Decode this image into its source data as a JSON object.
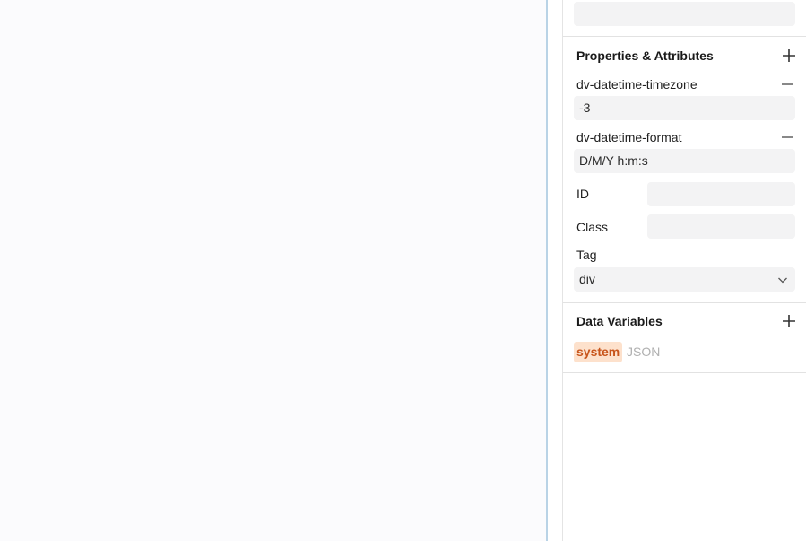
{
  "properties": {
    "title": "Properties & Attributes",
    "attributes": [
      {
        "name": "dv-datetime-timezone",
        "value": "-3"
      },
      {
        "name": "dv-datetime-format",
        "value": "D/M/Y h:m:s"
      }
    ],
    "id_label": "ID",
    "id_value": "",
    "class_label": "Class",
    "class_value": "",
    "tag_label": "Tag",
    "tag_value": "div"
  },
  "data_variables": {
    "title": "Data Variables",
    "items": [
      {
        "name": "system",
        "type": "JSON"
      }
    ]
  },
  "colors": {
    "accent_chip_bg": "#fde1cc",
    "accent_chip_text": "#c8541a",
    "canvas_edge": "#b9d3e6"
  }
}
